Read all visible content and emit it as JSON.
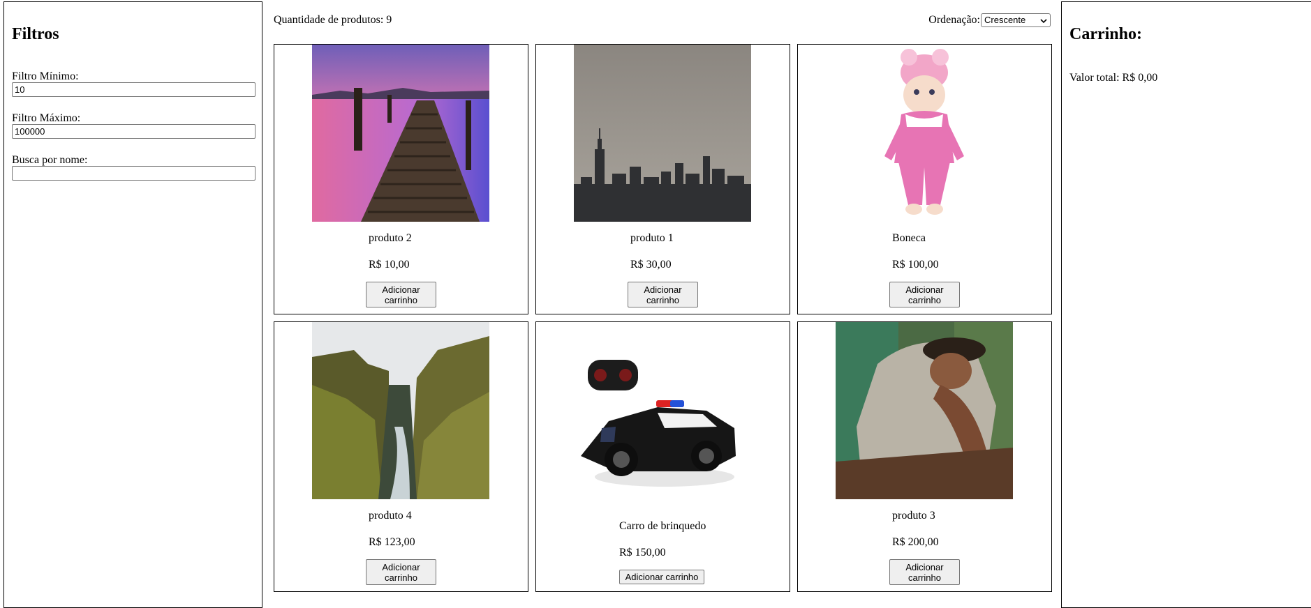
{
  "filters": {
    "title": "Filtros",
    "min_label": "Filtro Mínimo:",
    "min_value": "10",
    "max_label": "Filtro Máximo:",
    "max_value": "100000",
    "search_label": "Busca por nome:",
    "search_value": ""
  },
  "toolbar": {
    "product_count": "Quantidade de produtos: 9",
    "sort_label": "Ordenação:",
    "sort_selected": "Crescente"
  },
  "products": [
    {
      "name": "produto 2",
      "price": "R$ 10,00",
      "button": "Adicionar carrinho",
      "image": "pier-sunset-photo"
    },
    {
      "name": "produto 1",
      "price": "R$ 30,00",
      "button": "Adicionar carrinho",
      "image": "city-skyline-photo"
    },
    {
      "name": "Boneca",
      "price": "R$ 100,00",
      "button": "Adicionar carrinho",
      "image": "baby-doll-photo"
    },
    {
      "name": "produto 4",
      "price": "R$ 123,00",
      "button": "Adicionar carrinho",
      "image": "canyon-river-photo"
    },
    {
      "name": "Carro de brinquedo",
      "price": "R$ 150,00",
      "button": "Adicionar carrinho",
      "image": "toy-police-car-photo"
    },
    {
      "name": "produto 3",
      "price": "R$ 200,00",
      "button": "Adicionar carrinho",
      "image": "man-sleeping-in-car-photo"
    }
  ],
  "cart": {
    "title": "Carrinho:",
    "total": "Valor total: R$ 0,00"
  }
}
